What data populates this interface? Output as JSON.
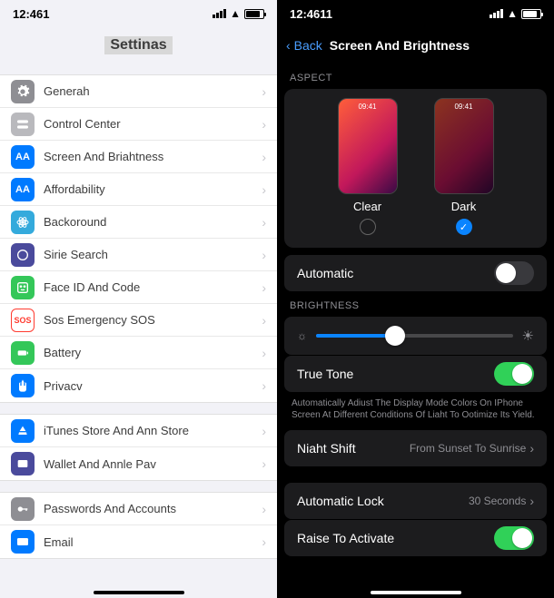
{
  "left": {
    "time": "12:461",
    "title": "Settinas",
    "groups": [
      [
        {
          "icon": "gear",
          "color": "gray",
          "label": "Generah"
        },
        {
          "icon": "switches",
          "color": "softgray",
          "label": "Control Center"
        },
        {
          "icon": "aa",
          "color": "blue",
          "label": "Screen And Briahtness"
        },
        {
          "icon": "aa",
          "color": "blue",
          "label": "Affordability"
        },
        {
          "icon": "atom",
          "color": "lblue",
          "label": "Backoround"
        },
        {
          "icon": "siri",
          "color": "dpurple",
          "label": "Sirie Search"
        },
        {
          "icon": "face",
          "color": "green",
          "label": "Face ID And Code"
        },
        {
          "icon": "sos",
          "color": "red",
          "label": "Sos Emergency SOS"
        },
        {
          "icon": "battery",
          "color": "green",
          "label": "Battery"
        },
        {
          "icon": "hand",
          "color": "blue",
          "label": "Privacv"
        }
      ],
      [
        {
          "icon": "astore",
          "color": "blue",
          "label": "iTunes Store And Ann Store"
        },
        {
          "icon": "wallet",
          "color": "dpurple",
          "label": "Wallet And Annle Pav"
        }
      ],
      [
        {
          "icon": "key",
          "color": "gray",
          "label": "Passwords And Accounts"
        },
        {
          "icon": "mail",
          "color": "blue",
          "label": "Email"
        }
      ]
    ]
  },
  "right": {
    "time": "12:4611",
    "back": "Back",
    "title": "Screen And Brightness",
    "aspect_label": "ASPECT",
    "preview_time": "09:41",
    "clear": "Clear",
    "dark": "Dark",
    "automatic": "Automatic",
    "automatic_on": false,
    "brightness_label": "BRIGHTNESS",
    "brightness_pct": 40,
    "true_tone": "True Tone",
    "true_tone_on": true,
    "true_tone_desc": "Automatically Adiust The Display Mode Colors On IPhone Screen At Different Conditions Of Liaht To Ootimize Its Yield.",
    "night_shift": "Niaht Shift",
    "night_shift_val": "From Sunset To Sunrise",
    "auto_lock": "Automatic Lock",
    "auto_lock_val": "30 Seconds",
    "raise": "Raise To Activate",
    "raise_on": true
  }
}
